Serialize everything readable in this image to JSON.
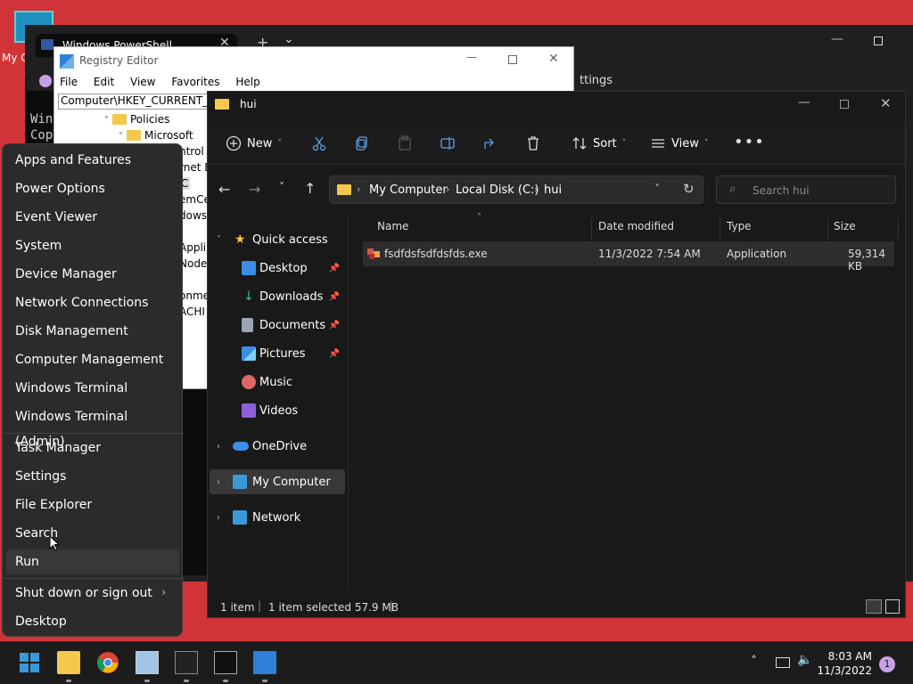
{
  "desktop": {
    "icon_label": "My C"
  },
  "powershell": {
    "tab_title": "Windows PowerShell",
    "new_tab": "+",
    "dropdown": "⌄",
    "console_line1": "Win",
    "console_line2": "Cop"
  },
  "settings_strip": {
    "text": "ttings"
  },
  "registry": {
    "title": "Registry Editor",
    "menu": [
      "File",
      "Edit",
      "View",
      "Favorites",
      "Help"
    ],
    "address": "Computer\\HKEY_CURRENT_USE",
    "tree": [
      {
        "label": "Policies"
      },
      {
        "label": "Microsoft"
      }
    ],
    "partial": [
      "ntrol P",
      "rnet E",
      "C",
      "emCe",
      "dows",
      "Appli",
      "Node",
      "onme",
      "ACHI"
    ]
  },
  "context_menu": {
    "group1": [
      "Apps and Features",
      "Power Options",
      "Event Viewer",
      "System",
      "Device Manager",
      "Network Connections",
      "Disk Management",
      "Computer Management",
      "Windows Terminal",
      "Windows Terminal (Admin)"
    ],
    "group2": [
      "Task Manager",
      "Settings",
      "File Explorer",
      "Search",
      "Run"
    ],
    "group3": [
      "Shut down or sign out",
      "Desktop"
    ]
  },
  "explorer": {
    "title": "hui",
    "toolbar": {
      "new": "New",
      "sort": "Sort",
      "view": "View"
    },
    "breadcrumb": [
      "My Computer",
      "Local Disk (C:)",
      "hui"
    ],
    "search_placeholder": "Search hui",
    "sidebar": {
      "quick_access": "Quick access",
      "items": [
        "Desktop",
        "Downloads",
        "Documents",
        "Pictures",
        "Music",
        "Videos"
      ],
      "onedrive": "OneDrive",
      "my_computer": "My Computer",
      "network": "Network"
    },
    "columns": [
      "Name",
      "Date modified",
      "Type",
      "Size"
    ],
    "files": [
      {
        "name": "fsdfdsfsdfdsfds.exe",
        "date": "11/3/2022 7:54 AM",
        "type": "Application",
        "size": "59,314 KB"
      }
    ],
    "status": {
      "count": "1 item",
      "selected": "1 item selected  57.9 MB"
    }
  },
  "taskbar": {
    "time": "8:03 AM",
    "date": "11/3/2022",
    "notifications": "1"
  },
  "colors": {
    "accent": "#0078d4",
    "desktop_bg": "#d13438",
    "dark_bg": "#191919"
  }
}
